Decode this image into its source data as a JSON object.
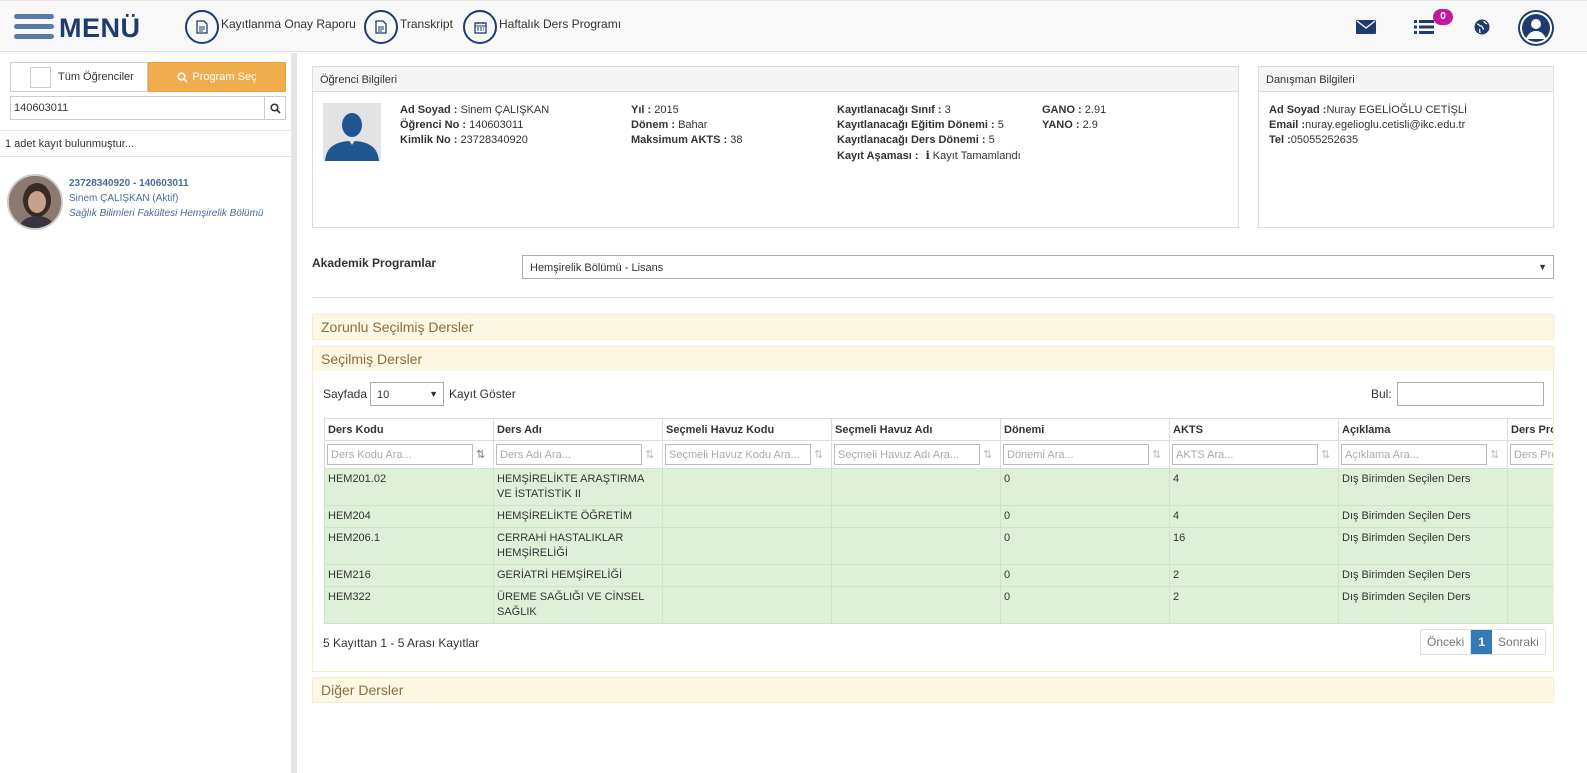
{
  "topbar": {
    "menu_label": "MENÜ",
    "links": [
      {
        "label": "Kayıtlanma Onay Raporu",
        "icon": "document-icon"
      },
      {
        "label": "Transkript",
        "icon": "document-icon"
      },
      {
        "label": "Haftalık Ders Programı",
        "icon": "calendar-icon"
      }
    ],
    "notification_count": "0",
    "accent_color": "#1f3b6e",
    "badge_color": "#c4199f"
  },
  "sidebar": {
    "tab_all": "Tüm Öğrenciler",
    "tab_program": "Program Seç",
    "search_value": "140603011",
    "result_count": "1 adet kayıt bulunmuştur...",
    "student": {
      "ids": "23728340920 - 140603011",
      "name": "Sinem ÇALIŞKAN (Aktif)",
      "faculty": "Sağlık Bilimleri Fakültesi Hemşirelik Bölümü"
    }
  },
  "ogrenci": {
    "title": "Öğrenci Bilgileri",
    "ad_soyad_k": "Ad Soyad :",
    "ad_soyad_v": "Sinem ÇALIŞKAN",
    "ogr_no_k": "Öğrenci No :",
    "ogr_no_v": "140603011",
    "kimlik_k": "Kimlik No :",
    "kimlik_v": "23728340920",
    "yil_k": "Yıl :",
    "yil_v": "2015",
    "donem_k": "Dönem :",
    "donem_v": "Bahar",
    "akts_k": "Maksimum AKTS :",
    "akts_v": "38",
    "sinif_k": "Kayıtlanacağı Sınıf :",
    "sinif_v": "3",
    "egitim_k": "Kayıtlanacağı Eğitim Dönemi :",
    "egitim_v": "5",
    "ders_donem_k": "Kayıtlanacağı Ders Dönemi :",
    "ders_donem_v": "5",
    "asama_k": "Kayıt Aşaması :",
    "asama_v": "Kayıt Tamamlandı",
    "gano_k": "GANO :",
    "gano_v": "2.91",
    "yano_k": "YANO :",
    "yano_v": "2.9"
  },
  "danisman": {
    "title": "Danışman Bilgileri",
    "ad_k": "Ad Soyad :",
    "ad_v": "Nuray EGELİOĞLU CETİŞLİ",
    "email_k": "Email :",
    "email_v": "nuray.egelioglu.cetisli@ikc.edu.tr",
    "tel_k": "Tel :",
    "tel_v": "05055252635"
  },
  "program": {
    "label": "Akademik Programlar",
    "selected": "Hemşirelik Bölümü - Lisans"
  },
  "sections": {
    "zorunlu": "Zorunlu Seçilmiş Dersler",
    "secilmis": "Seçilmiş Dersler",
    "diger": "Diğer Dersler"
  },
  "table": {
    "page_size_label": "Sayfada",
    "page_size": "10",
    "show_label": "Kayıt Göster",
    "find_label": "Bul:",
    "headers": [
      "Ders Kodu",
      "Ders Adı",
      "Seçmeli Havuz Kodu",
      "Seçmeli Havuz Adı",
      "Dönemi",
      "AKTS",
      "Açıklama",
      "Ders Pro"
    ],
    "filters": [
      "Ders Kodu Ara...",
      "Ders Adı Ara...",
      "Seçmeli Havuz Kodu Ara...",
      "Seçmeli Havuz Adı Ara...",
      "Dönemi Ara...",
      "AKTS Ara...",
      "Açıklama Ara...",
      "Ders Pro"
    ],
    "rows": [
      [
        "HEM201.02",
        "HEMŞİRELİKTE ARAŞTIRMA VE İSTATİSTİK II",
        "",
        "",
        "0",
        "4",
        "Dış Birimden Seçilen Ders",
        ""
      ],
      [
        "HEM204",
        "HEMŞİRELİKTE ÖĞRETİM",
        "",
        "",
        "0",
        "4",
        "Dış Birimden Seçilen Ders",
        ""
      ],
      [
        "HEM206.1",
        "CERRAHİ HASTALIKLAR HEMŞİRELİĞİ",
        "",
        "",
        "0",
        "16",
        "Dış Birimden Seçilen Ders",
        ""
      ],
      [
        "HEM216",
        "GERİATRİ HEMŞİRELİĞİ",
        "",
        "",
        "0",
        "2",
        "Dış Birimden Seçilen Ders",
        ""
      ],
      [
        "HEM322",
        "ÜREME SAĞLIĞI VE CİNSEL SAĞLIK",
        "",
        "",
        "0",
        "2",
        "Dış Birimden Seçilen Ders",
        ""
      ]
    ],
    "footer_info": "5 Kayıttan 1 - 5 Arası Kayıtlar",
    "pager": {
      "prev": "Önceki",
      "current": "1",
      "next": "Sonraki"
    },
    "row_color": "#dff0d8"
  }
}
